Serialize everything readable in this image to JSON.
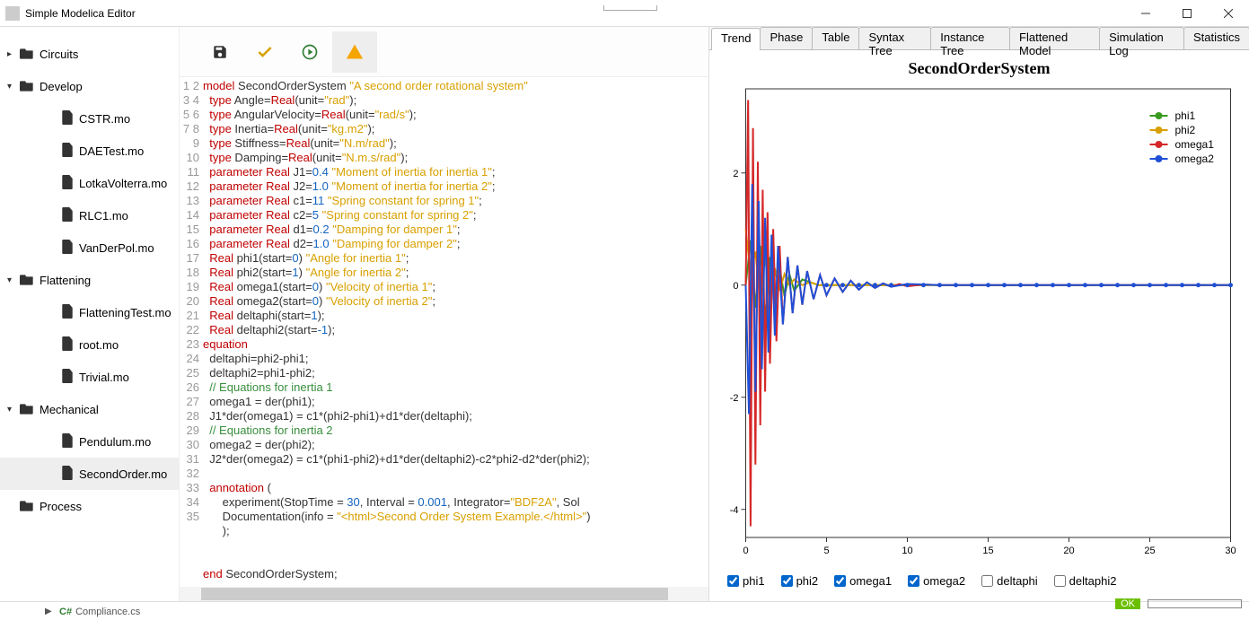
{
  "window": {
    "title": "Simple Modelica Editor"
  },
  "sidebar": {
    "items": [
      {
        "kind": "folder",
        "label": "Circuits",
        "expanded": false,
        "caret": "right"
      },
      {
        "kind": "folder",
        "label": "Develop",
        "expanded": true,
        "caret": "down"
      },
      {
        "kind": "file",
        "label": "CSTR.mo"
      },
      {
        "kind": "file",
        "label": "DAETest.mo"
      },
      {
        "kind": "file",
        "label": "LotkaVolterra.mo"
      },
      {
        "kind": "file",
        "label": "RLC1.mo"
      },
      {
        "kind": "file",
        "label": "VanDerPol.mo"
      },
      {
        "kind": "folder",
        "label": "Flattening",
        "expanded": true,
        "caret": "down"
      },
      {
        "kind": "file",
        "label": "FlatteningTest.mo"
      },
      {
        "kind": "file",
        "label": "root.mo"
      },
      {
        "kind": "file",
        "label": "Trivial.mo"
      },
      {
        "kind": "folder",
        "label": "Mechanical",
        "expanded": true,
        "caret": "down"
      },
      {
        "kind": "file",
        "label": "Pendulum.mo"
      },
      {
        "kind": "file",
        "label": "SecondOrder.mo",
        "selected": true
      },
      {
        "kind": "folder",
        "label": "Process",
        "expanded": false,
        "caret": "none"
      }
    ]
  },
  "editor": {
    "lines": [
      "model SecondOrderSystem \"A second order rotational system\"",
      "  type Angle=Real(unit=\"rad\");",
      "  type AngularVelocity=Real(unit=\"rad/s\");",
      "  type Inertia=Real(unit=\"kg.m2\");",
      "  type Stiffness=Real(unit=\"N.m/rad\");",
      "  type Damping=Real(unit=\"N.m.s/rad\");",
      "  parameter Real J1=0.4 \"Moment of inertia for inertia 1\";",
      "  parameter Real J2=1.0 \"Moment of inertia for inertia 2\";",
      "  parameter Real c1=11 \"Spring constant for spring 1\";",
      "  parameter Real c2=5 \"Spring constant for spring 2\";",
      "  parameter Real d1=0.2 \"Damping for damper 1\";",
      "  parameter Real d2=1.0 \"Damping for damper 2\";",
      "  Real phi1(start=0) \"Angle for inertia 1\";",
      "  Real phi2(start=1) \"Angle for inertia 2\";",
      "  Real omega1(start=0) \"Velocity of inertia 1\";",
      "  Real omega2(start=0) \"Velocity of inertia 2\";",
      "  Real deltaphi(start=1);",
      "  Real deltaphi2(start=-1);",
      "equation",
      "  deltaphi=phi2-phi1;",
      "  deltaphi2=phi1-phi2;",
      "  // Equations for inertia 1",
      "  omega1 = der(phi1);",
      "  J1*der(omega1) = c1*(phi2-phi1)+d1*der(deltaphi);",
      "  // Equations for inertia 2",
      "  omega2 = der(phi2);",
      "  J2*der(omega2) = c1*(phi1-phi2)+d1*der(deltaphi2)-c2*phi2-d2*der(phi2);",
      "",
      "  annotation (",
      "      experiment(StopTime = 30, Interval = 0.001, Integrator=\"BDF2A\", Sol",
      "      Documentation(info = \"<html>Second Order System Example.</html>\")",
      "      );",
      "",
      "",
      "end SecondOrderSystem;"
    ],
    "cursor_line": 31
  },
  "tabs": {
    "items": [
      "Trend",
      "Phase",
      "Table",
      "Syntax Tree",
      "Instance Tree",
      "Flattened Model",
      "Simulation Log",
      "Statistics"
    ],
    "active": 0
  },
  "chart_data": {
    "type": "line",
    "title": "SecondOrderSystem",
    "xlabel": "",
    "ylabel": "",
    "xlim": [
      0,
      30
    ],
    "ylim": [
      -4.5,
      3.5
    ],
    "xticks": [
      0,
      5,
      10,
      15,
      20,
      25,
      30
    ],
    "yticks": [
      -4,
      -2,
      0,
      2
    ],
    "legend_position": "top-right",
    "series": [
      {
        "name": "phi1",
        "color": "#3a9a1f",
        "x": [
          0,
          0.3,
          0.6,
          0.9,
          1.2,
          1.5,
          1.8,
          2.1,
          2.4,
          2.7,
          3,
          3.5,
          4,
          4.5,
          5,
          6,
          7,
          8,
          10,
          12,
          15,
          20,
          30
        ],
        "y": [
          0,
          0.8,
          -0.4,
          0.7,
          -0.6,
          0.5,
          -0.3,
          0.3,
          -0.2,
          0.2,
          -0.1,
          0.1,
          0.05,
          0,
          0,
          0,
          0,
          0,
          0,
          0,
          0,
          0,
          0
        ]
      },
      {
        "name": "phi2",
        "color": "#d8a000",
        "x": [
          0,
          0.3,
          0.6,
          0.9,
          1.2,
          1.5,
          1.8,
          2.1,
          2.4,
          2.7,
          3,
          3.5,
          4,
          4.5,
          5,
          6,
          7,
          8,
          10,
          12,
          15,
          20,
          30
        ],
        "y": [
          1,
          0.2,
          0.6,
          -0.3,
          0.5,
          -0.2,
          0.3,
          -0.1,
          0.2,
          0,
          0.1,
          0,
          0.05,
          0,
          0,
          0,
          0,
          0,
          0,
          0,
          0,
          0,
          0
        ]
      },
      {
        "name": "omega1",
        "color": "#d62728",
        "x": [
          0,
          0.15,
          0.3,
          0.45,
          0.6,
          0.75,
          0.9,
          1.05,
          1.2,
          1.35,
          1.5,
          1.7,
          1.9,
          2.1,
          2.3,
          2.6,
          2.9,
          3.2,
          3.5,
          3.8,
          4.2,
          4.6,
          5,
          5.5,
          6,
          6.5,
          7,
          7.5,
          8,
          8.5,
          9,
          9.5,
          10,
          11,
          12,
          13,
          14,
          16,
          20,
          25,
          30
        ],
        "y": [
          0,
          3.3,
          -4.3,
          2.8,
          -3.2,
          2.2,
          -2.5,
          1.7,
          -1.9,
          1.3,
          -1.4,
          1,
          -1,
          0.7,
          -0.7,
          0.5,
          -0.5,
          0.35,
          -0.35,
          0.25,
          -0.25,
          0.18,
          -0.18,
          0.12,
          -0.12,
          0.08,
          -0.08,
          0.05,
          -0.05,
          0.03,
          -0.03,
          0.02,
          -0.02,
          0.01,
          0,
          0,
          0,
          0,
          0,
          0,
          0
        ]
      },
      {
        "name": "omega2",
        "color": "#1f4fd6",
        "x": [
          0,
          0.2,
          0.4,
          0.6,
          0.8,
          1,
          1.2,
          1.4,
          1.6,
          1.8,
          2,
          2.3,
          2.6,
          2.9,
          3.2,
          3.5,
          3.8,
          4.2,
          4.6,
          5,
          5.5,
          6,
          6.5,
          7,
          7.5,
          8,
          8.5,
          9,
          10,
          11,
          12,
          14,
          16,
          20,
          25,
          30
        ],
        "y": [
          0,
          -2.3,
          1.8,
          -1.9,
          1.5,
          -1.5,
          1.2,
          -1.2,
          0.9,
          -0.9,
          0.7,
          -0.7,
          0.5,
          -0.5,
          0.35,
          -0.35,
          0.25,
          -0.25,
          0.18,
          -0.18,
          0.12,
          -0.12,
          0.08,
          -0.08,
          0.05,
          -0.05,
          0.03,
          -0.03,
          0.02,
          0.01,
          0,
          0,
          0,
          0,
          0,
          0
        ]
      }
    ],
    "markers_series": "omega2",
    "markers_x": [
      5,
      6,
      7,
      8,
      9,
      10,
      11,
      12,
      13,
      14,
      15,
      16,
      17,
      18,
      19,
      20,
      21,
      22,
      23,
      24,
      25,
      26,
      27,
      28,
      29,
      30
    ]
  },
  "checkboxes": [
    {
      "label": "phi1",
      "checked": true
    },
    {
      "label": "phi2",
      "checked": true
    },
    {
      "label": "omega1",
      "checked": true
    },
    {
      "label": "omega2",
      "checked": true
    },
    {
      "label": "deltaphi",
      "checked": false
    },
    {
      "label": "deltaphi2",
      "checked": false
    }
  ],
  "status": {
    "ok": "OK"
  },
  "footer": {
    "file": "Compliance.cs"
  }
}
